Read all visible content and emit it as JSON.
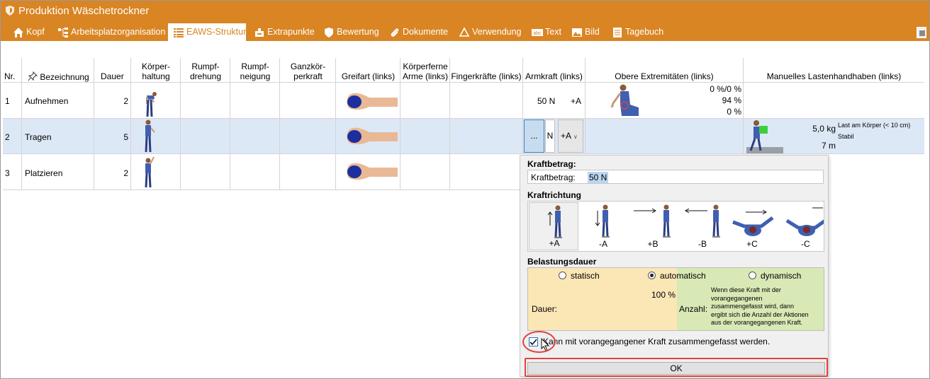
{
  "window": {
    "title": "Produktion Wäschetrockner"
  },
  "tabs": [
    {
      "label": "Kopf",
      "icon": "home-icon"
    },
    {
      "label": "Arbeitsplatzorganisation",
      "icon": "org-chart-icon"
    },
    {
      "label": "EAWS-Struktur",
      "icon": "list-icon",
      "active": true
    },
    {
      "label": "Extrapunkte",
      "icon": "extra-points-icon"
    },
    {
      "label": "Bewertung",
      "icon": "shield-icon"
    },
    {
      "label": "Dokumente",
      "icon": "paperclip-icon"
    },
    {
      "label": "Verwendung",
      "icon": "recycle-icon"
    },
    {
      "label": "Text",
      "icon": "text-abc-icon"
    },
    {
      "label": "Bild",
      "icon": "image-icon"
    },
    {
      "label": "Tagebuch",
      "icon": "diary-icon"
    }
  ],
  "columns": {
    "nr": "Nr.",
    "bezeichnung": "Bezeichnung",
    "dauer": "Dauer",
    "koerperhaltung": [
      "Körper-",
      "haltung"
    ],
    "rumpfdrehung": [
      "Rumpf-",
      "drehung"
    ],
    "rumpfneigung": [
      "Rumpf-",
      "neigung"
    ],
    "ganzkoerperkraft": [
      "Ganzkör-",
      "perkraft"
    ],
    "greifart": "Greifart (links)",
    "arme": [
      "Körperferne",
      "Arme (links)"
    ],
    "finger": "Fingerkräfte (links)",
    "armkraft": "Armkraft (links)",
    "obere": "Obere Extremitäten (links)",
    "lasten": "Manuelles Lastenhandhaben (links)"
  },
  "rows": [
    {
      "nr": "1",
      "name": "Aufnehmen",
      "dauer": "2",
      "armkraft_val": "50 N",
      "armkraft_dir": "+A",
      "obere": [
        "0 %/0 %",
        "94 %",
        "0 %"
      ]
    },
    {
      "nr": "2",
      "name": "Tragen",
      "dauer": "5",
      "edit_btn": "...",
      "edit_unit": "N",
      "edit_dir": "+A",
      "last_weight": "5,0 kg",
      "last_note": "Last am Körper (< 10 cm)",
      "last_state": "Stabil",
      "last_dist": "7 m"
    },
    {
      "nr": "3",
      "name": "Platzieren",
      "dauer": "2"
    }
  ],
  "popup": {
    "kraftbetrag_title": "Kraftbetrag:",
    "kraftbetrag_label": "Kraftbetrag:",
    "kraftbetrag_value": "50 N",
    "kraftrichtung_title": "Kraftrichtung",
    "directions": [
      "+A",
      "-A",
      "+B",
      "-B",
      "+C",
      "-C"
    ],
    "belastung_title": "Belastungsdauer",
    "options": [
      "statisch",
      "automatisch",
      "dynamisch"
    ],
    "selected_option": "automatisch",
    "dauer_label": "Dauer:",
    "dauer_pct": "100 %",
    "anzahl_label": "Anzahl:",
    "anzahl_text": [
      "Wenn diese Kraft mit der",
      "vorangegangenen",
      "zusammengefasst wird, dann",
      "ergibt sich die Anzahl der Aktionen",
      "aus der vorangegangenen Kraft."
    ],
    "checkbox_label": "Kann mit vorangegangener Kraft zusammengefasst werden.",
    "checkbox_checked": true,
    "ok_label": "OK"
  },
  "colors": {
    "accent": "#d98523",
    "selection": "#dde8f6",
    "highlight": "#e0443e"
  }
}
